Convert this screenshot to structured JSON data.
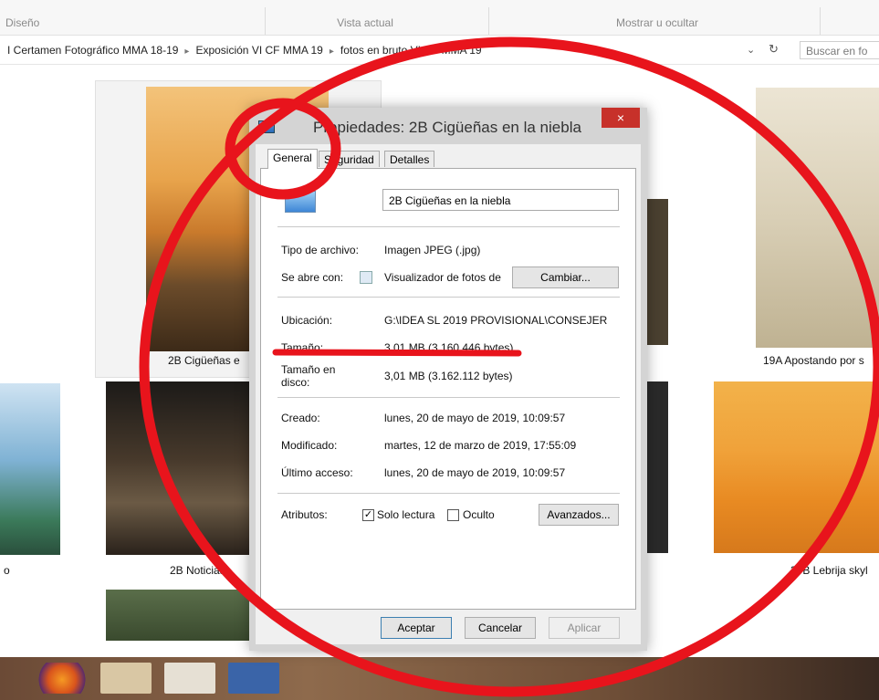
{
  "ribbon": {
    "groups": [
      "Diseño",
      "Vista actual",
      "Mostrar u ocultar"
    ]
  },
  "addressbar": {
    "breadcrumbs": [
      "I Certamen Fotográfico MMA 18-19",
      "Exposición VI CF MMA 19",
      "fotos en bruto VI CF MMA 19"
    ],
    "search_placeholder": "Buscar en fo"
  },
  "thumbnails": [
    {
      "label": "2B Cigüeñas e"
    },
    {
      "label": "19A Apostando por s"
    },
    {
      "label": "2B Noticias"
    },
    {
      "label": "39B Lebrija skyl"
    },
    {
      "label": "o"
    }
  ],
  "dialog": {
    "title": "Propiedades: 2B Cigüeñas en la niebla",
    "close_glyph": "×",
    "tabs": [
      "General",
      "Seguridad",
      "Detalles"
    ],
    "file_name": "2B Cigüeñas en la niebla",
    "rows": {
      "tipo_label": "Tipo de archivo:",
      "tipo_value": "Imagen JPEG (.jpg)",
      "abre_label": "Se abre con:",
      "abre_value": "Visualizador de fotos de",
      "cambiar": "Cambiar...",
      "ubicacion_label": "Ubicación:",
      "ubicacion_value": "G:\\IDEA SL 2019 PROVISIONAL\\CONSEJER",
      "tamano_label": "Tamaño:",
      "tamano_value": "3,01 MB (3.160.446 bytes)",
      "tamano_disco_label_1": "Tamaño en",
      "tamano_disco_label_2": "disco:",
      "tamano_disco_value": "3,01 MB (3.162.112 bytes)",
      "creado_label": "Creado:",
      "creado_value": "lunes, 20 de mayo de 2019, 10:09:57",
      "modificado_label": "Modificado:",
      "modificado_value": "martes, 12 de marzo de 2019, 17:55:09",
      "acceso_label": "Último acceso:",
      "acceso_value": "lunes, 20 de mayo de 2019, 10:09:57",
      "atributos_label": "Atributos:",
      "solo_lectura": "Solo lectura",
      "solo_lectura_checked": true,
      "oculto": "Oculto",
      "oculto_checked": false,
      "avanzados": "Avanzados..."
    },
    "buttons": {
      "aceptar": "Aceptar",
      "cancelar": "Cancelar",
      "aplicar": "Aplicar"
    }
  },
  "colors": {
    "annotation_red": "#e8141c",
    "close_red": "#c7312a"
  }
}
